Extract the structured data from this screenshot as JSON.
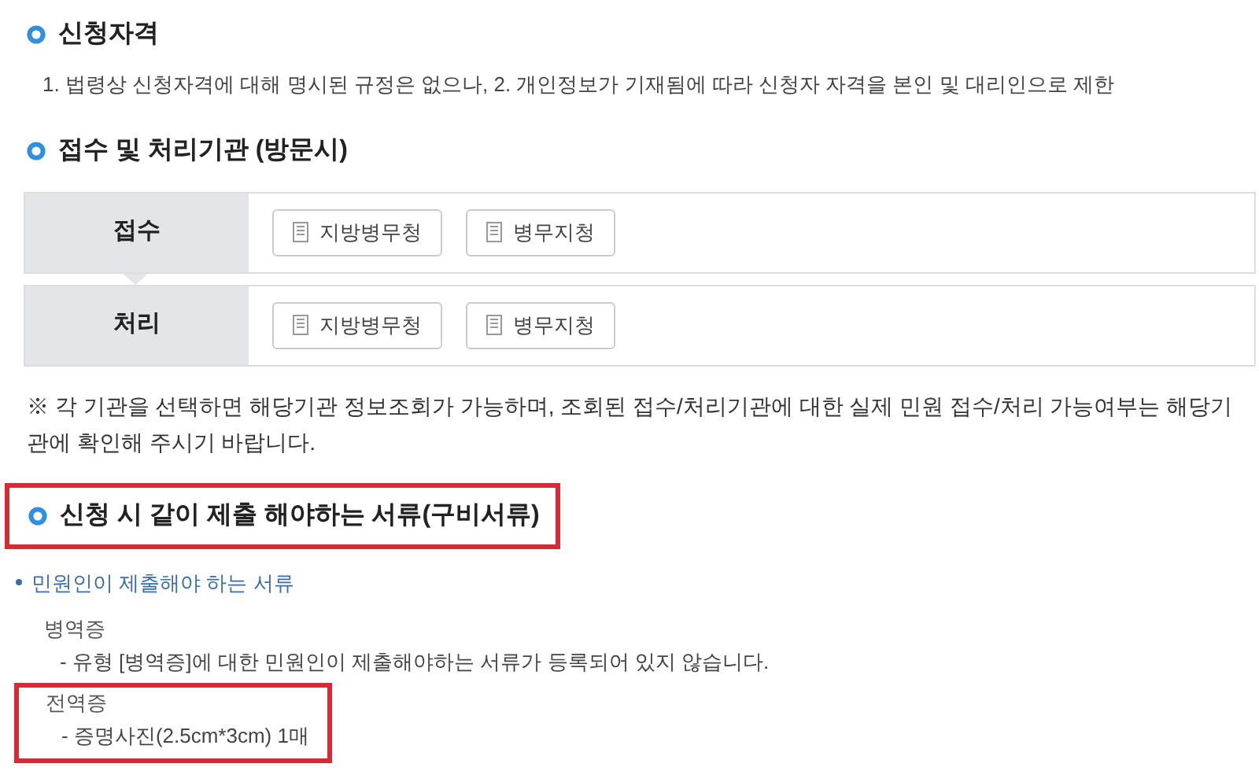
{
  "sections": [
    {
      "title": "신청자격",
      "highlighted": false,
      "kind": "text",
      "text": "1. 법령상 신청자격에 대해 명시된 규정은 없으나, 2. 개인정보가 기재됨에 따라 신청자 자격을 본인 및 대리인으로 제한"
    },
    {
      "title": "접수 및 처리기관 (방문시)",
      "highlighted": false,
      "kind": "agencies",
      "rows": [
        {
          "label": "접수",
          "agencies": [
            "지방병무청",
            "병무지청"
          ]
        },
        {
          "label": "처리",
          "agencies": [
            "지방병무청",
            "병무지청"
          ]
        }
      ],
      "note": "※ 각 기관을 선택하면 해당기관 정보조회가 가능하며, 조회된 접수/처리기관에 대한 실제 민원 접수/처리 가능여부는 해당기관에 확인해 주시기 바랍니다."
    },
    {
      "title": "신청 시 같이 제출 해야하는 서류(구비서류)",
      "highlighted": true,
      "kind": "documents",
      "subtitle": "민원인이 제출해야 하는 서류",
      "documents": [
        {
          "name": "병역증",
          "detail": "- 유형 [병역증]에 대한 민원인이 제출해야하는 서류가 등록되어 있지 않습니다.",
          "highlighted": false
        },
        {
          "name": "전역증",
          "detail": "- 증명사진(2.5cm*3cm) 1매",
          "highlighted": true
        }
      ]
    }
  ]
}
